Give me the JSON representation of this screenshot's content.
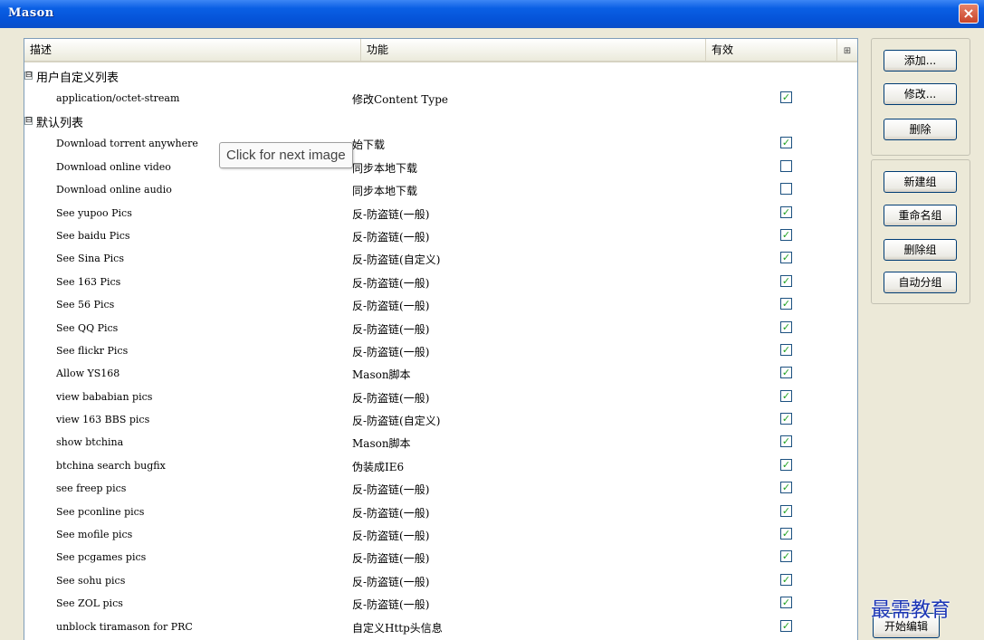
{
  "window": {
    "title": "Mason",
    "close_label": "×"
  },
  "table": {
    "columns": {
      "description": "描述",
      "function": "功能",
      "valid": "有效",
      "config_icon": "⊞"
    },
    "groups": [
      {
        "name": "用户自定义列表",
        "toggle": "⊟",
        "rows": [
          {
            "desc": "application/octet-stream",
            "func": "修改Content Type",
            "checked": true
          }
        ]
      },
      {
        "name": "默认列表",
        "toggle": "⊟",
        "rows": [
          {
            "desc": "Download torrent anywhere",
            "func": "始下载",
            "checked": true
          },
          {
            "desc": "Download online video",
            "func": "同步本地下载",
            "checked": false
          },
          {
            "desc": "Download online audio",
            "func": "同步本地下载",
            "checked": false
          },
          {
            "desc": "See yupoo Pics",
            "func": "反-防盗链(一般)",
            "checked": true
          },
          {
            "desc": "See baidu Pics",
            "func": "反-防盗链(一般)",
            "checked": true
          },
          {
            "desc": "See Sina Pics",
            "func": "反-防盗链(自定义)",
            "checked": true
          },
          {
            "desc": "See 163 Pics",
            "func": "反-防盗链(一般)",
            "checked": true
          },
          {
            "desc": "See 56 Pics",
            "func": "反-防盗链(一般)",
            "checked": true
          },
          {
            "desc": "See QQ Pics",
            "func": "反-防盗链(一般)",
            "checked": true
          },
          {
            "desc": "See flickr Pics",
            "func": "反-防盗链(一般)",
            "checked": true
          },
          {
            "desc": "Allow YS168",
            "func": "Mason脚本",
            "checked": true
          },
          {
            "desc": "view bababian pics",
            "func": "反-防盗链(一般)",
            "checked": true
          },
          {
            "desc": "view 163 BBS pics",
            "func": "反-防盗链(自定义)",
            "checked": true
          },
          {
            "desc": "show btchina",
            "func": "Mason脚本",
            "checked": true
          },
          {
            "desc": "btchina search bugfix",
            "func": "伪装成IE6",
            "checked": true
          },
          {
            "desc": "see freep pics",
            "func": "反-防盗链(一般)",
            "checked": true
          },
          {
            "desc": "See pconline pics",
            "func": "反-防盗链(一般)",
            "checked": true
          },
          {
            "desc": "See mofile pics",
            "func": "反-防盗链(一般)",
            "checked": true
          },
          {
            "desc": "See pcgames pics",
            "func": "反-防盗链(一般)",
            "checked": true
          },
          {
            "desc": "See sohu pics",
            "func": "反-防盗链(一般)",
            "checked": true
          },
          {
            "desc": "See ZOL pics",
            "func": "反-防盗链(一般)",
            "checked": true
          },
          {
            "desc": "unblock tiramason for PRC",
            "func": "自定义Http头信息",
            "checked": true
          }
        ]
      }
    ]
  },
  "tooltip": "Click for next image",
  "buttons": {
    "add": "添加...",
    "modify": "修改...",
    "delete": "删除",
    "new_group": "新建组",
    "rename_group": "重命名组",
    "delete_group": "删除组",
    "auto_group": "自动分组"
  },
  "bottom_button": "开始编辑",
  "watermark": "最需教育",
  "colors": {
    "title_bar": "#0553d8",
    "close_button": "#c9442a",
    "check_mark": "#21a121",
    "watermark": "#1b35b5"
  }
}
